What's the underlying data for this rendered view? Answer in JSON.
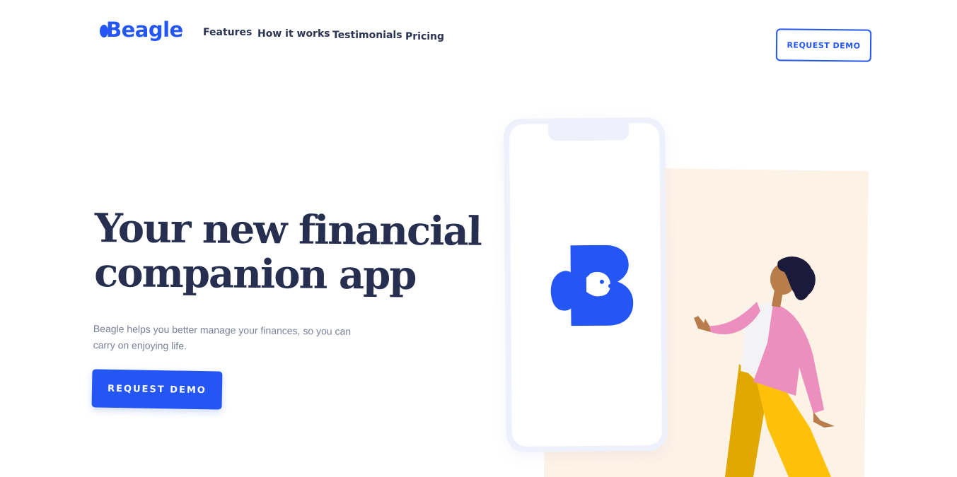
{
  "brand": {
    "name": "Beagle",
    "color": "#2456f5"
  },
  "nav": {
    "items": [
      {
        "label": "Features"
      },
      {
        "label": "How it works"
      },
      {
        "label": "Testimonials"
      },
      {
        "label": "Pricing"
      }
    ],
    "cta_label": "REQUEST DEMO"
  },
  "hero": {
    "title_line1": "Your new financial",
    "title_line2": "companion app",
    "subtitle": "Beagle helps you better manage your finances, so you can carry on enjoying life.",
    "cta_label": "REQUEST DEMO"
  },
  "illustration": {
    "phone_icon": "beagle-b-logo-icon",
    "figure": "walking-person-illustration",
    "colors": {
      "cream": "#fdf2e6",
      "pink": "#ec8fbf",
      "yellow": "#ffc107",
      "phone": "#eef1fb"
    }
  }
}
